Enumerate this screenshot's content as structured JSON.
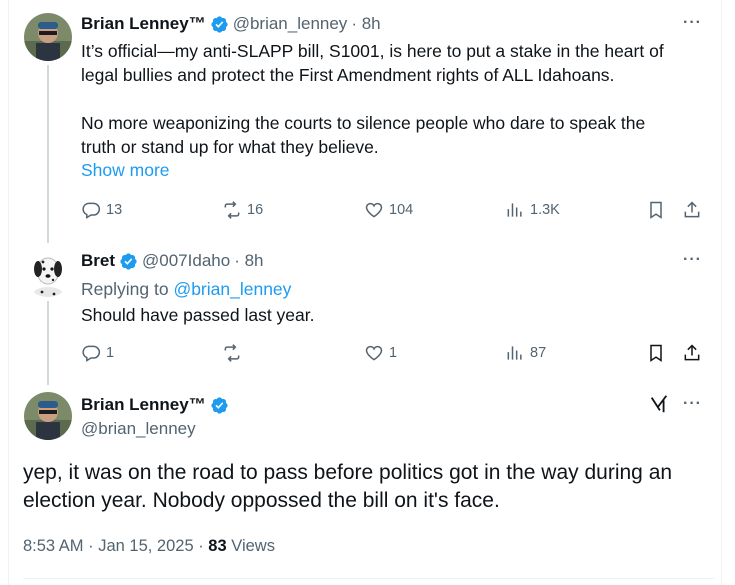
{
  "tweet1": {
    "name": "Brian Lenney™",
    "handle": "@brian_lenney",
    "time": "· 8h",
    "line1": "It’s official—my anti-SLAPP bill, S1001, is here to put a stake in the heart of",
    "line2": "legal bullies and protect the First Amendment rights of ALL Idahoans.",
    "line3": "No more weaponizing the courts to silence people who dare to speak the",
    "line4": "truth or stand up for what they believe.",
    "show_more": "Show more",
    "replies": "13",
    "reposts": "16",
    "likes": "104",
    "views": "1.3K"
  },
  "tweet2": {
    "name": "Bret",
    "handle": "@007Idaho",
    "time": "· 8h",
    "replying_prefix": "Replying to",
    "replying_to": "@brian_lenney",
    "text": "Should have passed last year.",
    "replies": "1",
    "likes": "1",
    "views": "87"
  },
  "main": {
    "name": "Brian Lenney™",
    "handle": "@brian_lenney",
    "line1": "yep, it was on the road to pass before politics got in the way during an",
    "line2": "election year. Nobody oppossed the bill on it's face.",
    "timestamp": "8:53 AM · Jan 15, 2025 ·",
    "views_count": "83",
    "views_label": "Views"
  },
  "icons": {
    "more": "more-icon",
    "verified": "verified-badge-icon",
    "grok": "grok-icon"
  },
  "colors": {
    "accent": "#1d9bf0",
    "muted": "#536471",
    "text": "#0f1419"
  }
}
